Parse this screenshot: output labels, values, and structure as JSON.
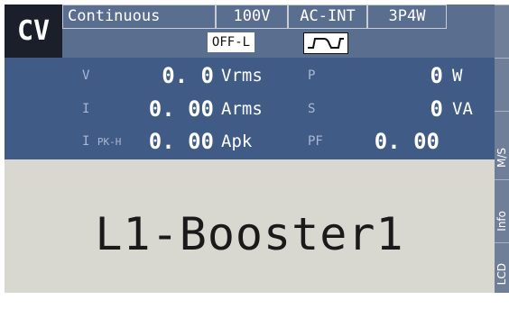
{
  "header": {
    "mode": "CV",
    "status": "Continuous",
    "voltage_range": "100V",
    "source": "AC-INT",
    "wiring": "3P4W",
    "output_state": "OFF-L",
    "waveform_icon": "ac-wave-icon"
  },
  "measurements": {
    "voltage": {
      "label": "V",
      "value": "0. 0",
      "unit": "Vrms"
    },
    "current": {
      "label": "I",
      "value": "0. 00",
      "unit": "Arms"
    },
    "peak": {
      "label": "I",
      "label_sub": "PK-H",
      "value": "0. 00",
      "unit": "Apk"
    },
    "power": {
      "label": "P",
      "value": "0",
      "unit": "W"
    },
    "apparent": {
      "label": "S",
      "value": "0",
      "unit": "VA"
    },
    "pf": {
      "label": "PF",
      "value": "0. 00"
    }
  },
  "main": {
    "display_text": "L1-Booster1"
  },
  "softkeys": [
    "M/S",
    "Info",
    "LCD"
  ],
  "colors": {
    "header_bg": "#5a6e8f",
    "mode_bg": "#1b1f2a",
    "panel_bg": "#3f5b86",
    "main_bg": "#d8d8d0",
    "softkey_bg": "#6f7f98"
  }
}
